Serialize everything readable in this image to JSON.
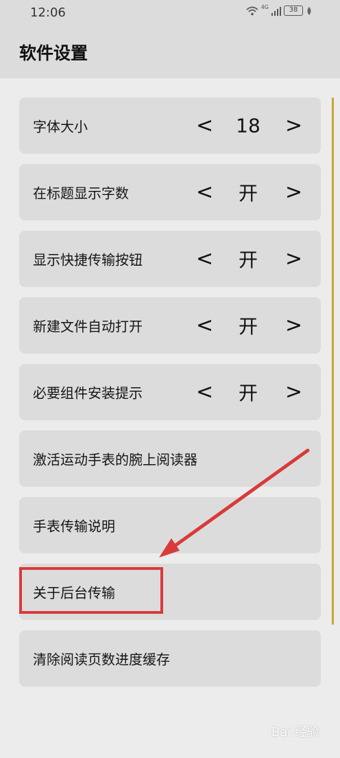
{
  "status_bar": {
    "time": "12:06",
    "network": "4G",
    "battery": "38"
  },
  "header": {
    "title": "软件设置"
  },
  "settings": [
    {
      "label": "字体大小",
      "prev": "<",
      "value": "18",
      "next": ">"
    },
    {
      "label": "在标题显示字数",
      "prev": "<",
      "value": "开",
      "next": ">"
    },
    {
      "label": "显示快捷传输按钮",
      "prev": "<",
      "value": "开",
      "next": ">"
    },
    {
      "label": "新建文件自动打开",
      "prev": "<",
      "value": "开",
      "next": ">"
    },
    {
      "label": "必要组件安装提示",
      "prev": "<",
      "value": "开",
      "next": ">"
    },
    {
      "label": "激活运动手表的腕上阅读器"
    },
    {
      "label": "手表传输说明"
    },
    {
      "label": "关于后台传输"
    },
    {
      "label": "清除阅读页数进度缓存"
    }
  ],
  "annotation": {
    "highlight_color": "#d93a3a",
    "arrow_color": "#d93a3a"
  },
  "watermark": "Bai 经验"
}
